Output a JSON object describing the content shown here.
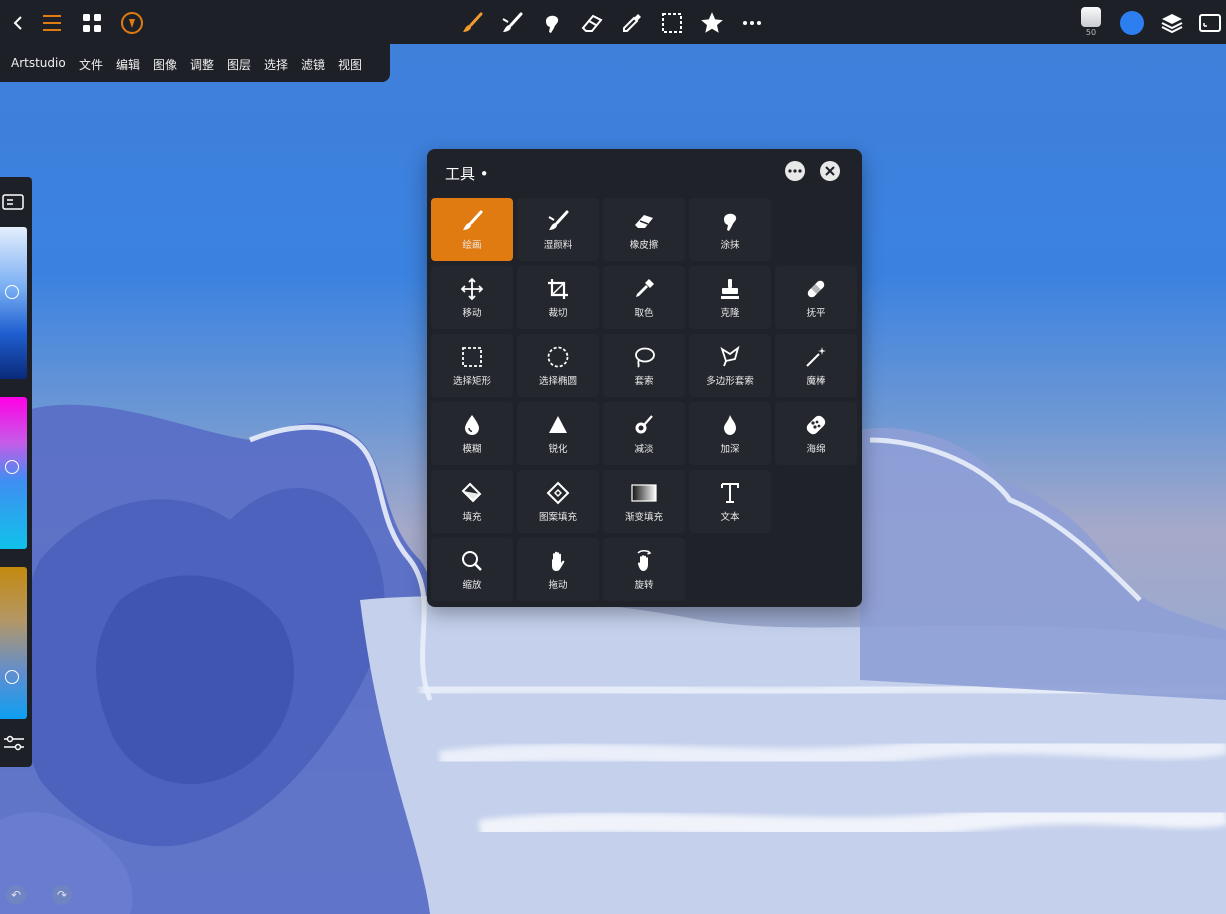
{
  "menubar": {
    "items": [
      "Artstudio",
      "文件",
      "编辑",
      "图像",
      "调整",
      "图层",
      "选择",
      "滤镜",
      "视图"
    ]
  },
  "topbar": {
    "left_icons": [
      "back-icon",
      "menu-icon",
      "grid-icon",
      "app-logo-icon"
    ],
    "tool_icons": [
      "brush-icon",
      "wet-paint-icon",
      "smudge-icon",
      "eraser-icon",
      "eyedropper-icon",
      "select-rect-icon",
      "favorites-star-icon",
      "more-icon"
    ],
    "brush_size": "50",
    "current_color": "#2d7ff0",
    "right_icons": [
      "layers-icon",
      "fullscreen-icon"
    ]
  },
  "colors": {
    "accent": "#e07b12",
    "panel_bg": "#1f2228",
    "cell_bg": "#24272d",
    "bar_bg": "#1d2026"
  },
  "tools_panel": {
    "title": "工具 •",
    "tools": [
      {
        "label": "绘画",
        "icon": "paint-brush-icon",
        "active": true
      },
      {
        "label": "湿颜料",
        "icon": "wet-paint-icon"
      },
      {
        "label": "橡皮擦",
        "icon": "eraser-icon"
      },
      {
        "label": "涂抹",
        "icon": "smudge-icon"
      },
      {
        "label": "移动",
        "icon": "move-icon"
      },
      {
        "label": "裁切",
        "icon": "crop-icon"
      },
      {
        "label": "取色",
        "icon": "eyedropper-icon"
      },
      {
        "label": "克隆",
        "icon": "clone-stamp-icon"
      },
      {
        "label": "抚平",
        "icon": "heal-bandage-icon"
      },
      {
        "label": "选择矩形",
        "icon": "select-rect-icon"
      },
      {
        "label": "选择椭圆",
        "icon": "select-ellipse-icon"
      },
      {
        "label": "套索",
        "icon": "lasso-icon"
      },
      {
        "label": "多边形套索",
        "icon": "polygon-lasso-icon"
      },
      {
        "label": "魔棒",
        "icon": "magic-wand-icon"
      },
      {
        "label": "模糊",
        "icon": "blur-drop-icon"
      },
      {
        "label": "锐化",
        "icon": "sharpen-triangle-icon"
      },
      {
        "label": "减淡",
        "icon": "dodge-icon"
      },
      {
        "label": "加深",
        "icon": "burn-icon"
      },
      {
        "label": "海绵",
        "icon": "sponge-icon"
      },
      {
        "label": "填充",
        "icon": "fill-bucket-icon"
      },
      {
        "label": "图案填充",
        "icon": "pattern-fill-icon"
      },
      {
        "label": "渐变填充",
        "icon": "gradient-fill-icon"
      },
      {
        "label": "文本",
        "icon": "text-icon"
      },
      {
        "label": "缩放",
        "icon": "zoom-icon"
      },
      {
        "label": "拖动",
        "icon": "hand-icon"
      },
      {
        "label": "旋转",
        "icon": "rotate-hand-icon"
      }
    ]
  }
}
